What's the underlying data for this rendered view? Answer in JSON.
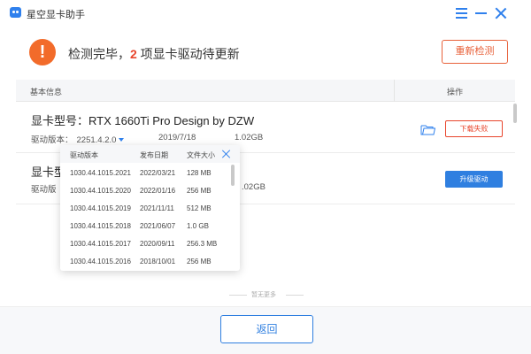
{
  "app": {
    "title": "星空显卡助手"
  },
  "status": {
    "prefix": "检测完毕，",
    "count": "2",
    "suffix": " 项显卡驱动待更新",
    "recheck_label": "重新检测"
  },
  "table": {
    "col_info": "基本信息",
    "col_action": "操作"
  },
  "devices": [
    {
      "model_label": "显卡型号：RTX 1660Ti Pro Design by DZW",
      "version_label": "驱动版本：",
      "version": "2251.4.2.0",
      "date": "2019/7/18",
      "size": "1.02GB",
      "action_label": "下载失败"
    },
    {
      "model_label": "显卡型",
      "version_label": "驱动版",
      "size": ".02GB",
      "action_label": "升级驱动"
    }
  ],
  "version_popup": {
    "headers": [
      "驱动版本",
      "发布日期",
      "文件大小"
    ],
    "rows": [
      {
        "version": "1030.44.1015.2021",
        "date": "2022/03/21",
        "size": "128 MB"
      },
      {
        "version": "1030.44.1015.2020",
        "date": "2022/01/16",
        "size": "256 MB"
      },
      {
        "version": "1030.44.1015.2019",
        "date": "2021/11/11",
        "size": "512 MB"
      },
      {
        "version": "1030.44.1015.2018",
        "date": "2021/06/07",
        "size": "1.0 GB"
      },
      {
        "version": "1030.44.1015.2017",
        "date": "2020/09/11",
        "size": "256.3 MB"
      },
      {
        "version": "1030.44.1015.2016",
        "date": "2018/10/01",
        "size": "256 MB"
      }
    ]
  },
  "no_more_label": "暂无更多",
  "back_label": "返回",
  "colors": {
    "accent": "#2f80ed",
    "warning": "#f26b2a",
    "error": "#e8452c"
  }
}
